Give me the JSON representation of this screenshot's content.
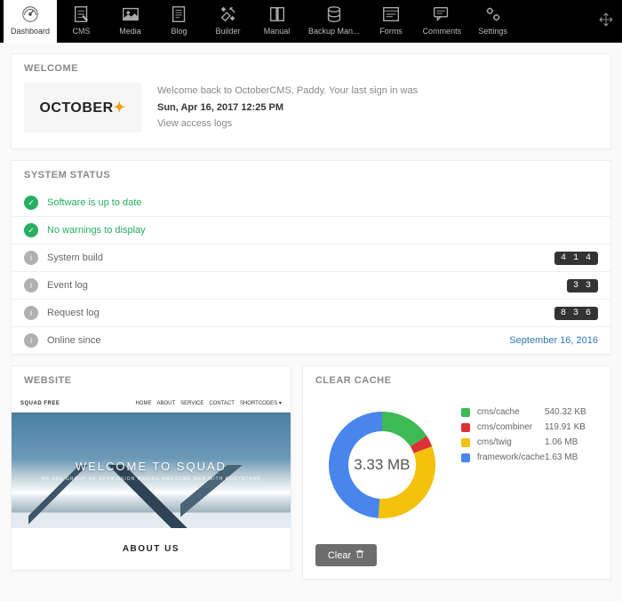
{
  "nav": {
    "items": [
      {
        "label": "Dashboard",
        "icon": "dashboard-icon",
        "active": true
      },
      {
        "label": "CMS",
        "icon": "cms-icon"
      },
      {
        "label": "Media",
        "icon": "media-icon"
      },
      {
        "label": "Blog",
        "icon": "blog-icon"
      },
      {
        "label": "Builder",
        "icon": "builder-icon"
      },
      {
        "label": "Manual",
        "icon": "manual-icon"
      },
      {
        "label": "Backup Man...",
        "icon": "backup-icon"
      },
      {
        "label": "Forms",
        "icon": "forms-icon"
      },
      {
        "label": "Comments",
        "icon": "comments-icon"
      },
      {
        "label": "Settings",
        "icon": "settings-icon"
      }
    ]
  },
  "welcome": {
    "heading": "WELCOME",
    "logo_text": "OCTOBER",
    "msg": "Welcome back to OctoberCMS, Paddy. Your last sign in was",
    "date": "Sun, Apr 16, 2017 12:25 PM",
    "link": "View access logs"
  },
  "status": {
    "heading": "SYSTEM STATUS",
    "rows": [
      {
        "type": "ok",
        "label": "Software is up to date"
      },
      {
        "type": "ok",
        "label": "No warnings to display"
      },
      {
        "type": "info",
        "label": "System build",
        "badge": "4 1 4"
      },
      {
        "type": "info",
        "label": "Event log",
        "badge": "3 3"
      },
      {
        "type": "info",
        "label": "Request log",
        "badge": "8 3 6"
      },
      {
        "type": "info",
        "label": "Online since",
        "link": "September 16, 2016"
      }
    ]
  },
  "website": {
    "heading": "WEBSITE",
    "nav": [
      "HOME",
      "ABOUT",
      "SERVICE",
      "CONTACT",
      "SHORTCODES"
    ],
    "brand": "SQUAD FREE",
    "hero_title": "WELCOME TO SQUAD",
    "hero_sub": "WE ARE GROUP OF SKYMISSION MAKING AWESOME WEB WITH BOOTSTRAP",
    "about": "ABOUT US"
  },
  "cache": {
    "heading": "CLEAR CACHE",
    "total": "3.33 MB",
    "items": [
      {
        "color": "#3cba54",
        "label": "cms/cache",
        "value": "540.32 KB"
      },
      {
        "color": "#db3236",
        "label": "cms/combiner",
        "value": "119.91 KB"
      },
      {
        "color": "#f4c20d",
        "label": "cms/twig",
        "value": "1.06 MB"
      },
      {
        "color": "#4885ed",
        "label": "framework/cache",
        "value": "1.63 MB"
      }
    ],
    "button": "Clear"
  },
  "chart_data": {
    "type": "pie",
    "title": "Clear Cache",
    "total_label": "3.33 MB",
    "series": [
      {
        "name": "cms/cache",
        "value_label": "540.32 KB",
        "value_mb": 0.5276,
        "color": "#3cba54"
      },
      {
        "name": "cms/combiner",
        "value_label": "119.91 KB",
        "value_mb": 0.1171,
        "color": "#db3236"
      },
      {
        "name": "cms/twig",
        "value_label": "1.06 MB",
        "value_mb": 1.06,
        "color": "#f4c20d"
      },
      {
        "name": "framework/cache",
        "value_label": "1.63 MB",
        "value_mb": 1.63,
        "color": "#4885ed"
      }
    ]
  }
}
